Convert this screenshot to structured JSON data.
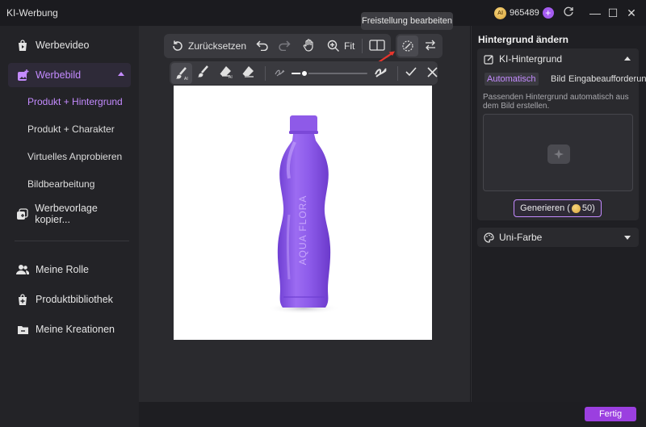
{
  "app": {
    "title": "KI-Werbung",
    "credits": "965489",
    "coin_label": "AI"
  },
  "window": {
    "minimize": "—",
    "maximize": "☐",
    "close": "✕"
  },
  "sidebar": {
    "items": [
      {
        "label": "Werbevideo",
        "icon": "video-bag-icon"
      },
      {
        "label": "Werbebild",
        "icon": "image-plus-icon"
      },
      {
        "label": "Werbevorlage kopier...",
        "icon": "copy-template-icon"
      },
      {
        "label": "Meine Rolle",
        "icon": "users-icon"
      },
      {
        "label": "Produktbibliothek",
        "icon": "bag-plus-icon"
      },
      {
        "label": "Meine Kreationen",
        "icon": "folder-icon"
      }
    ],
    "sub_items": [
      {
        "label": "Produkt + Hintergrund"
      },
      {
        "label": "Produkt + Charakter"
      },
      {
        "label": "Virtuelles Anprobieren"
      },
      {
        "label": "Bildbearbeitung"
      }
    ]
  },
  "toolbar": {
    "reset_label": "Zurücksetzen",
    "fit_label": "Fit",
    "tooltip": "Freistellung bearbeiten"
  },
  "product": {
    "brand": "AQUA FLORA"
  },
  "right_panel": {
    "title": "Hintergrund ändern",
    "ai_bg": {
      "title": "KI-Hintergrund",
      "tabs": [
        "Automatisch",
        "Bild",
        "Eingabeaufforderung"
      ],
      "description": "Passenden Hintergrund automatisch aus dem Bild erstellen.",
      "generate_label": "Generieren (",
      "generate_cost": "50)"
    },
    "uni_color": {
      "title": "Uni-Farbe"
    }
  },
  "footer": {
    "done_label": "Fertig"
  },
  "colors": {
    "accent": "#c48bff",
    "button": "#9b3fe0",
    "bottle": "#8a55e8"
  }
}
